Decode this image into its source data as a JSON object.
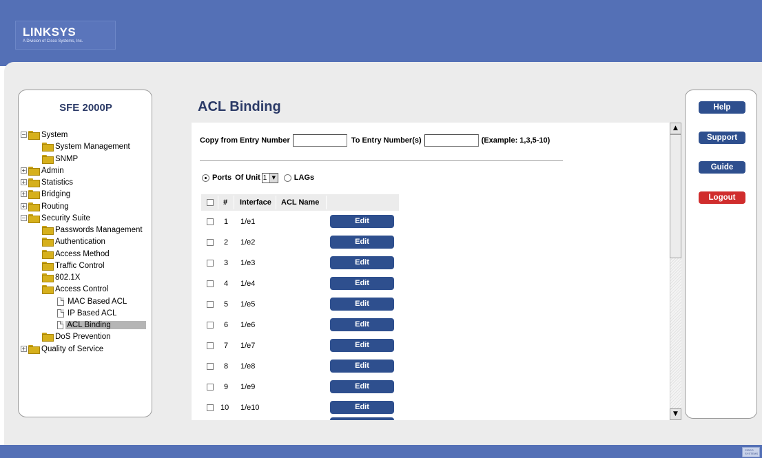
{
  "brand": {
    "name": "LINKSYS",
    "tagline": "A Division of Cisco Systems, Inc."
  },
  "footer": {
    "cisco_mark": "CISCO SYSTEMS"
  },
  "sidebar": {
    "device": "SFE 2000P",
    "tree": [
      {
        "label": "System",
        "level": 0,
        "expander": "−",
        "icon": "folder-open-icon"
      },
      {
        "label": "System Management",
        "level": 1,
        "icon": "folder-icon"
      },
      {
        "label": "SNMP",
        "level": 1,
        "icon": "folder-icon"
      },
      {
        "label": "Admin",
        "level": 0,
        "expander": "+",
        "icon": "folder-icon"
      },
      {
        "label": "Statistics",
        "level": 0,
        "expander": "+",
        "icon": "folder-icon"
      },
      {
        "label": "Bridging",
        "level": 0,
        "expander": "+",
        "icon": "folder-icon"
      },
      {
        "label": "Routing",
        "level": 0,
        "expander": "+",
        "icon": "folder-icon"
      },
      {
        "label": "Security Suite",
        "level": 0,
        "expander": "−",
        "icon": "folder-open-icon"
      },
      {
        "label": "Passwords Management",
        "level": 1,
        "icon": "folder-icon"
      },
      {
        "label": "Authentication",
        "level": 1,
        "icon": "folder-icon"
      },
      {
        "label": "Access Method",
        "level": 1,
        "icon": "folder-icon"
      },
      {
        "label": "Traffic Control",
        "level": 1,
        "icon": "folder-icon"
      },
      {
        "label": "802.1X",
        "level": 1,
        "icon": "folder-icon"
      },
      {
        "label": "Access Control",
        "level": 1,
        "icon": "folder-open-icon"
      },
      {
        "label": "MAC Based ACL",
        "level": 2,
        "icon": "page-icon"
      },
      {
        "label": "IP Based ACL",
        "level": 2,
        "icon": "page-icon"
      },
      {
        "label": "ACL Binding",
        "level": 2,
        "icon": "page-icon",
        "selected": true
      },
      {
        "label": "DoS Prevention",
        "level": 1,
        "icon": "folder-icon"
      },
      {
        "label": "Quality of Service",
        "level": 0,
        "expander": "+",
        "icon": "folder-icon"
      }
    ]
  },
  "main": {
    "title": "ACL Binding",
    "copy": {
      "from_label": "Copy from Entry Number",
      "from_value": "",
      "to_label": "To Entry Number(s)",
      "to_value": "",
      "example": "(Example: 1,3,5-10)"
    },
    "filter": {
      "ports_label": "Ports",
      "of_unit_label": "Of Unit",
      "unit_value": "1",
      "lags_label": "LAGs",
      "selected": "Ports"
    },
    "table": {
      "headers": {
        "num": "#",
        "interface": "Interface",
        "acl_name": "ACL Name"
      },
      "rows": [
        {
          "num": "1",
          "interface": "1/e1",
          "acl_name": "",
          "action": "Edit"
        },
        {
          "num": "2",
          "interface": "1/e2",
          "acl_name": "",
          "action": "Edit"
        },
        {
          "num": "3",
          "interface": "1/e3",
          "acl_name": "",
          "action": "Edit"
        },
        {
          "num": "4",
          "interface": "1/e4",
          "acl_name": "",
          "action": "Edit"
        },
        {
          "num": "5",
          "interface": "1/e5",
          "acl_name": "",
          "action": "Edit"
        },
        {
          "num": "6",
          "interface": "1/e6",
          "acl_name": "",
          "action": "Edit"
        },
        {
          "num": "7",
          "interface": "1/e7",
          "acl_name": "",
          "action": "Edit"
        },
        {
          "num": "8",
          "interface": "1/e8",
          "acl_name": "",
          "action": "Edit"
        },
        {
          "num": "9",
          "interface": "1/e9",
          "acl_name": "",
          "action": "Edit"
        },
        {
          "num": "10",
          "interface": "1/e10",
          "acl_name": "",
          "action": "Edit"
        }
      ]
    }
  },
  "side_buttons": {
    "help": "Help",
    "support": "Support",
    "guide": "Guide",
    "logout": "Logout"
  },
  "colors": {
    "header_blue": "#5470b6",
    "button_blue": "#2e4f8e",
    "logout_red": "#d02d2d",
    "title_navy": "#2b3a67"
  }
}
